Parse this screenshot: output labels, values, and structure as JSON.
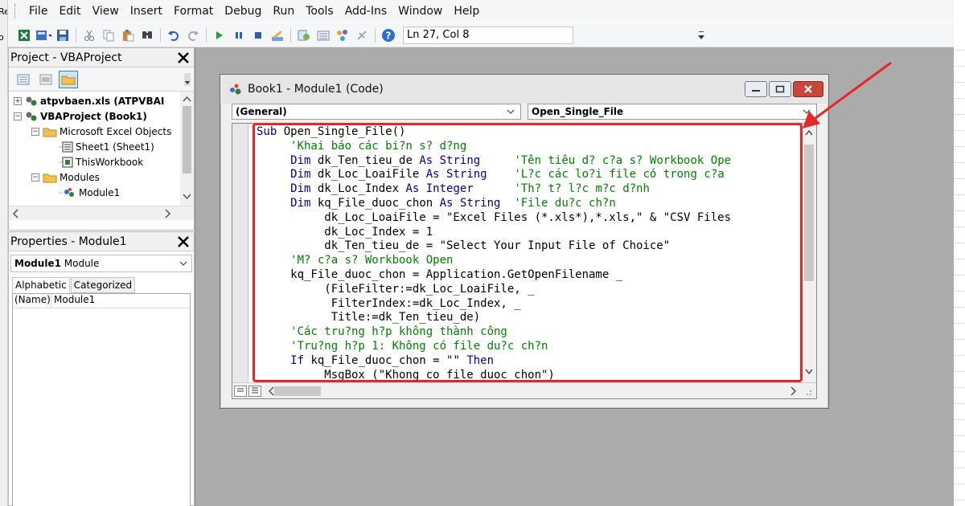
{
  "left_edge_text": [
    "Re",
    "o"
  ],
  "menu": [
    {
      "label": "File",
      "name": "menu-file"
    },
    {
      "label": "Edit",
      "name": "menu-edit"
    },
    {
      "label": "View",
      "name": "menu-view"
    },
    {
      "label": "Insert",
      "name": "menu-insert"
    },
    {
      "label": "Format",
      "name": "menu-format"
    },
    {
      "label": "Debug",
      "name": "menu-debug"
    },
    {
      "label": "Run",
      "name": "menu-run"
    },
    {
      "label": "Tools",
      "name": "menu-tools"
    },
    {
      "label": "Add-Ins",
      "name": "menu-addins"
    },
    {
      "label": "Window",
      "name": "menu-window"
    },
    {
      "label": "Help",
      "name": "menu-help"
    }
  ],
  "toolbar": {
    "cursor_position": "Ln 27, Col 8"
  },
  "project_pane": {
    "title": "Project - VBAProject",
    "tree": [
      {
        "label": "atpvbaen.xls (ATPVBAI",
        "bold": true,
        "expander": "+"
      },
      {
        "label": "VBAProject (Book1)",
        "bold": true,
        "expander": "−"
      },
      {
        "label": "Microsoft Excel Objects",
        "bold": false,
        "expander": "−"
      },
      {
        "label": "Sheet1 (Sheet1)",
        "bold": false,
        "expander": ""
      },
      {
        "label": "ThisWorkbook",
        "bold": false,
        "expander": ""
      },
      {
        "label": "Modules",
        "bold": false,
        "expander": "−"
      },
      {
        "label": "Module1",
        "bold": false,
        "expander": ""
      }
    ]
  },
  "properties_pane": {
    "title": "Properties - Module1",
    "object_bold": "Module1",
    "object_type": "Module",
    "tabs": [
      "Alphabetic",
      "Categorized"
    ],
    "rows": [
      {
        "key": "(Name)",
        "value": "Module1"
      }
    ]
  },
  "code_window": {
    "title": "Book1 - Module1 (Code)",
    "object_combo": "(General)",
    "procedure_combo": "Open_Single_File",
    "lines": [
      [
        {
          "t": "Sub ",
          "c": "kw"
        },
        {
          "t": "Open_Single_File()",
          "c": ""
        }
      ],
      [
        {
          "t": "     'Khai báo các bi?n s? d?ng",
          "c": "cm"
        }
      ],
      [
        {
          "t": "     ",
          "c": ""
        },
        {
          "t": "Dim",
          "c": "kw"
        },
        {
          "t": " dk_Ten_tieu_de ",
          "c": ""
        },
        {
          "t": "As String",
          "c": "kw"
        },
        {
          "t": "     ",
          "c": ""
        },
        {
          "t": "'Tên tiêu d? c?a s? Workbook Ope",
          "c": "cm"
        }
      ],
      [
        {
          "t": "     ",
          "c": ""
        },
        {
          "t": "Dim",
          "c": "kw"
        },
        {
          "t": " dk_Loc_LoaiFile ",
          "c": ""
        },
        {
          "t": "As String",
          "c": "kw"
        },
        {
          "t": "    ",
          "c": ""
        },
        {
          "t": "'L?c các lo?i file có trong c?a",
          "c": "cm"
        }
      ],
      [
        {
          "t": "     ",
          "c": ""
        },
        {
          "t": "Dim",
          "c": "kw"
        },
        {
          "t": " dk_Loc_Index ",
          "c": ""
        },
        {
          "t": "As Integer",
          "c": "kw"
        },
        {
          "t": "      ",
          "c": ""
        },
        {
          "t": "'Th? t? l?c m?c d?nh",
          "c": "cm"
        }
      ],
      [
        {
          "t": "     ",
          "c": ""
        },
        {
          "t": "Dim",
          "c": "kw"
        },
        {
          "t": " kq_File_duoc_chon ",
          "c": ""
        },
        {
          "t": "As String",
          "c": "kw"
        },
        {
          "t": "  ",
          "c": ""
        },
        {
          "t": "'File du?c ch?n",
          "c": "cm"
        }
      ],
      [
        {
          "t": "          dk_Loc_LoaiFile = \"Excel Files (*.xls*),*.xls,\" & \"CSV Files",
          "c": ""
        }
      ],
      [
        {
          "t": "          dk_Loc_Index = 1",
          "c": ""
        }
      ],
      [
        {
          "t": "          dk_Ten_tieu_de = \"Select Your Input File of Choice\"",
          "c": ""
        }
      ],
      [
        {
          "t": "     'M? c?a s? Workbook Open",
          "c": "cm"
        }
      ],
      [
        {
          "t": "     kq_File_duoc_chon = Application.GetOpenFilename _",
          "c": ""
        }
      ],
      [
        {
          "t": "          (FileFilter:=dk_Loc_LoaiFile, _",
          "c": ""
        }
      ],
      [
        {
          "t": "           FilterIndex:=dk_Loc_Index, _",
          "c": ""
        }
      ],
      [
        {
          "t": "           Title:=dk_Ten_tieu_de)",
          "c": ""
        }
      ],
      [
        {
          "t": "     'Các tru?ng h?p không thành công",
          "c": "cm"
        }
      ],
      [
        {
          "t": "     'Tru?ng h?p 1: Không có file du?c ch?n",
          "c": "cm"
        }
      ],
      [
        {
          "t": "     ",
          "c": ""
        },
        {
          "t": "If",
          "c": "kw"
        },
        {
          "t": " kq_File_duoc_chon = \"\" ",
          "c": ""
        },
        {
          "t": "Then",
          "c": "kw"
        }
      ],
      [
        {
          "t": "          MsgBox (\"Khong co file duoc chon\")",
          "c": ""
        }
      ]
    ]
  },
  "colors": {
    "annotation_red": "#e5262a",
    "keyword_blue": "#00008b",
    "comment_green": "#008000",
    "mdi_gray": "#ababab"
  }
}
